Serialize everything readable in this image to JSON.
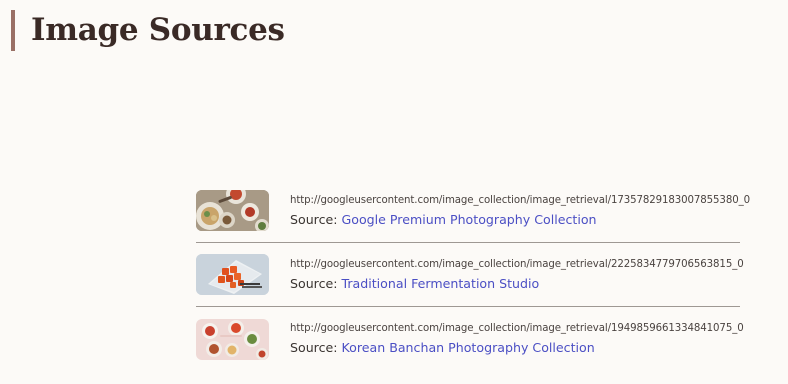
{
  "page": {
    "title": "Image Sources"
  },
  "sources": [
    {
      "url": "http://googleusercontent.com/image_collection/image_retrieval/17357829183007855380_0",
      "source_prefix": "Source: ",
      "source_name": "Google Premium Photography Collection",
      "thumbnail_icon": "korean-food-table-thumbnail"
    },
    {
      "url": "http://googleusercontent.com/image_collection/image_retrieval/2225834779706563815_0",
      "source_prefix": "Source: ",
      "source_name": "Traditional Fermentation Studio",
      "thumbnail_icon": "kimchi-plate-thumbnail"
    },
    {
      "url": "http://googleusercontent.com/image_collection/image_retrieval/1949859661334841075_0",
      "source_prefix": "Source: ",
      "source_name": "Korean Banchan Photography Collection",
      "thumbnail_icon": "banchan-bowls-thumbnail"
    }
  ],
  "colors": {
    "background": "#fcfaf7",
    "accent_bar": "#9a7066",
    "heading": "#3a2a26",
    "link": "#4b4fc4",
    "divider": "#9e9893"
  }
}
